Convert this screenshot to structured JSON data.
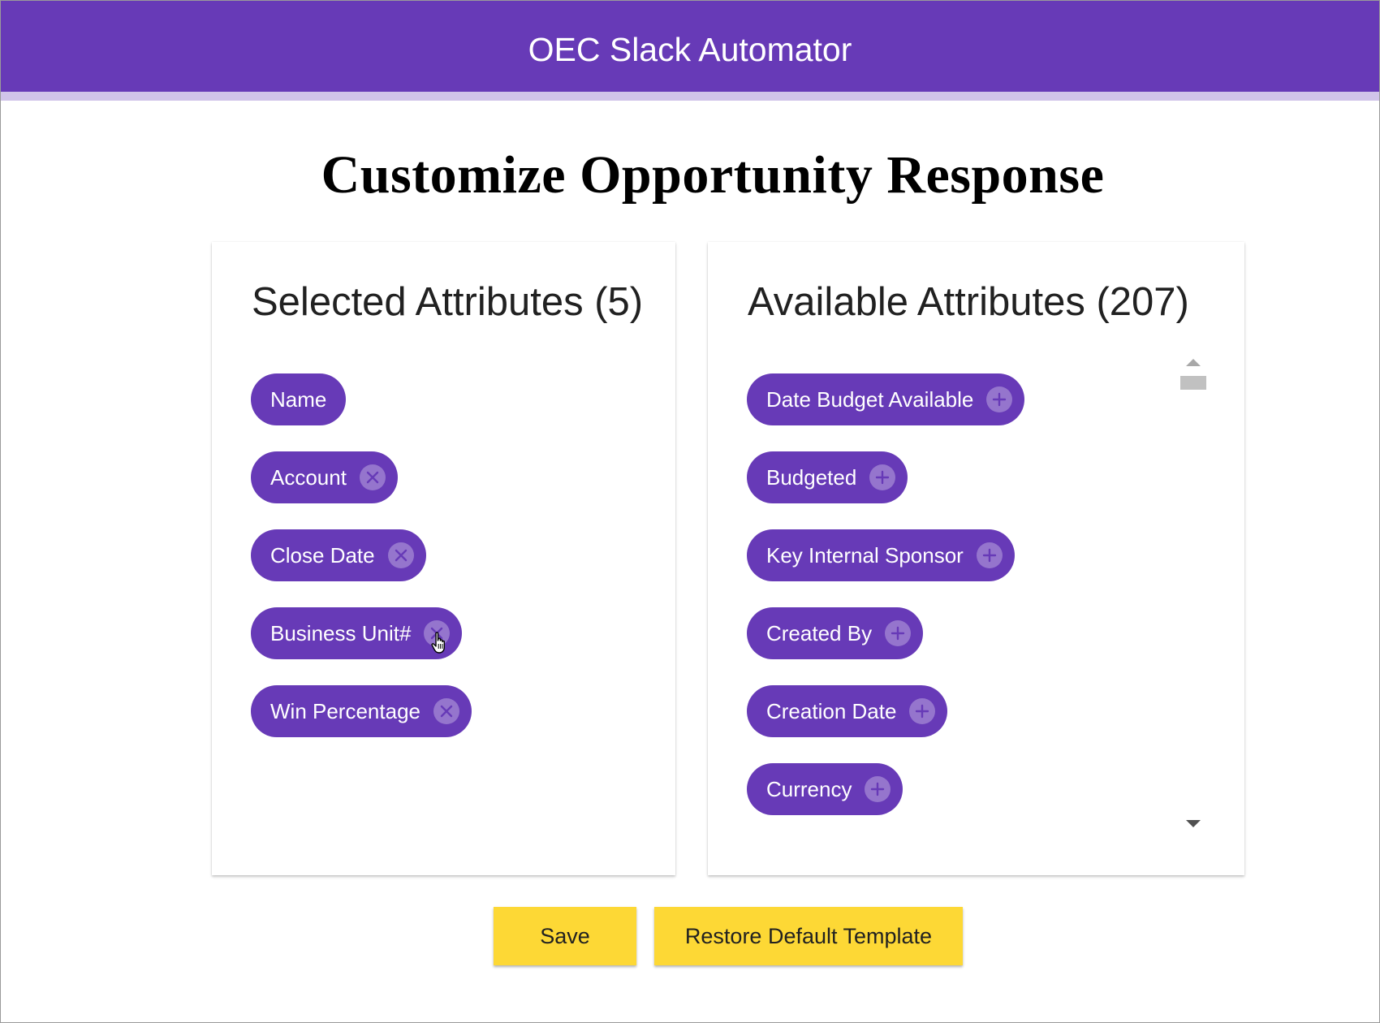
{
  "app": {
    "title": "OEC Slack Automator"
  },
  "page": {
    "title": "Customize Opportunity Response"
  },
  "selected": {
    "title": "Selected Attributes (5)",
    "items": [
      {
        "label": "Name",
        "removable": false
      },
      {
        "label": "Account",
        "removable": true
      },
      {
        "label": "Close Date",
        "removable": true
      },
      {
        "label": "Business Unit#",
        "removable": true
      },
      {
        "label": "Win Percentage",
        "removable": true
      }
    ],
    "remove_icon": "close-circle-icon"
  },
  "available": {
    "title": "Available Attributes (207)",
    "items": [
      {
        "label": "Date Budget Available"
      },
      {
        "label": "Budgeted"
      },
      {
        "label": "Key Internal Sponsor"
      },
      {
        "label": "Created By"
      },
      {
        "label": "Creation Date"
      },
      {
        "label": "Currency"
      }
    ],
    "add_icon": "add-circle-icon"
  },
  "actions": {
    "save_label": "Save",
    "restore_label": "Restore Default Template"
  },
  "colors": {
    "header": "#673ab7",
    "header_accent": "#d1c4e9",
    "chip": "#673ab7",
    "chip_icon_bg": "#9575cd",
    "button": "#fdd835"
  }
}
